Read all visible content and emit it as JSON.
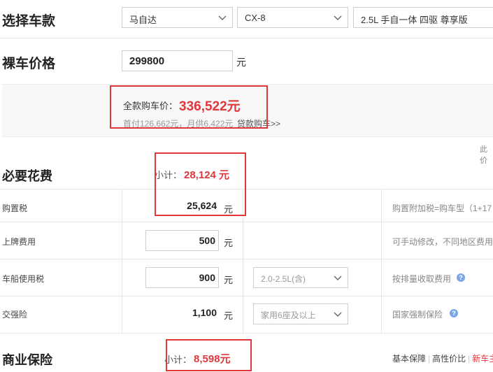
{
  "select_car": {
    "title": "选择车款",
    "brand": "马自达",
    "series": "CX-8",
    "model": "2.5L 手自一体 四驱 尊享版"
  },
  "price": {
    "title": "裸车价格",
    "value": "299800",
    "unit": "元"
  },
  "total": {
    "label": "全款购车价：",
    "value": "336,522元",
    "detail": "首付126,662元，月供6,422元",
    "loan_link": "贷款购车>>",
    "right_hint": "此价"
  },
  "required": {
    "title": "必要花费",
    "subtotal_label": "小计：",
    "subtotal_value": "28,124 元",
    "rows": [
      {
        "label": "购置税",
        "value": "25,624",
        "unit": "元",
        "note": "购置附加税=购车型（1+17"
      },
      {
        "label": "上牌费用",
        "value": "500",
        "unit": "元",
        "note": "可手动修改，不同地区费用"
      },
      {
        "label": "车船使用税",
        "value": "900",
        "unit": "元",
        "option": "2.0-2.5L(含)",
        "note": "按排量收取费用"
      },
      {
        "label": "交强险",
        "value": "1,100",
        "unit": "元",
        "option": "家用6座及以上",
        "note": "国家强制保险"
      }
    ]
  },
  "insurance": {
    "title": "商业保险",
    "subtotal_label": "小计：",
    "subtotal_value": "8,598元",
    "links": [
      "基本保障",
      "高性价比",
      "新车主"
    ]
  },
  "colors": {
    "accent": "#e0373d",
    "help": "#7aa7e6"
  },
  "icons": {
    "dropdown": "chevron-down-icon",
    "help": "question-icon"
  }
}
